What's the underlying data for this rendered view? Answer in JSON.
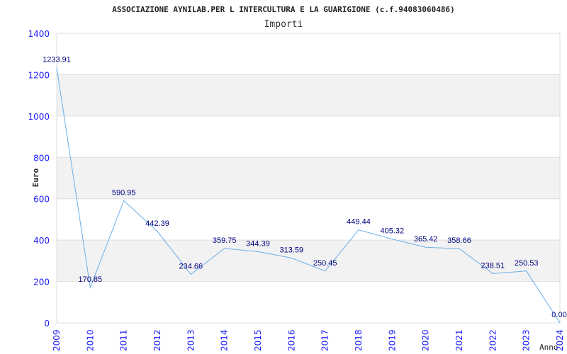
{
  "chart_data": {
    "type": "line",
    "title": "ASSOCIAZIONE AYNILAB.PER L INTERCULTURA E LA GUARIGIONE (c.f.94083060486)",
    "subtitle": "Importi",
    "xlabel": "Anno",
    "ylabel": "Euro",
    "ylim": [
      0,
      1400
    ],
    "yticks": [
      0,
      200,
      400,
      600,
      800,
      1000,
      1200,
      1400
    ],
    "grid": true,
    "categories": [
      "2009",
      "2010",
      "2011",
      "2012",
      "2013",
      "2014",
      "2015",
      "2016",
      "2017",
      "2018",
      "2019",
      "2020",
      "2021",
      "2022",
      "2023",
      "2024"
    ],
    "values": [
      1233.91,
      170.85,
      590.95,
      442.39,
      234.66,
      359.75,
      344.39,
      313.59,
      250.45,
      449.44,
      405.32,
      365.42,
      358.66,
      238.51,
      250.53,
      0.0
    ],
    "labels": [
      "1233.91",
      "170.85",
      "590.95",
      "442.39",
      "234.66",
      "359.75",
      "344.39",
      "313.59",
      "250.45",
      "449.44",
      "405.32",
      "365.42",
      "358.66",
      "238.51",
      "250.53",
      "0.00"
    ],
    "colors": {
      "line": "#6aaee8",
      "band": "#f2f2f2",
      "ticks": "#1a1aff",
      "labels": "#000080"
    }
  }
}
